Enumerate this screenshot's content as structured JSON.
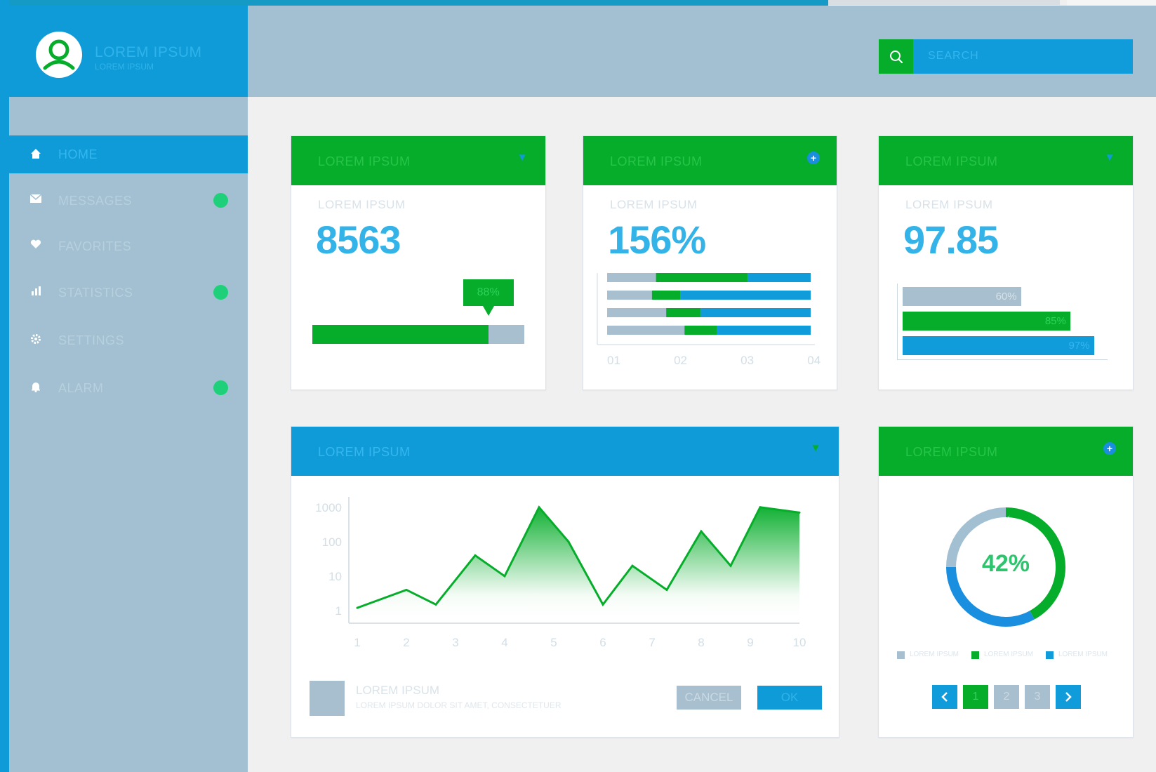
{
  "brand": {
    "title": "LOREM IPSUM",
    "subtitle": "LOREM IPSUM"
  },
  "search": {
    "placeholder": "SEARCH"
  },
  "nav": [
    {
      "label": "HOME",
      "icon": "home-icon",
      "glyph": "⌂",
      "active": true,
      "badge": false
    },
    {
      "label": "MESSAGES",
      "icon": "mail-icon",
      "glyph": "✉",
      "active": false,
      "badge": true
    },
    {
      "label": "FAVORITES",
      "icon": "heart-icon",
      "glyph": "♥",
      "active": false,
      "badge": false
    },
    {
      "label": "STATISTICS",
      "icon": "bar-chart-icon",
      "glyph": "▮",
      "active": false,
      "badge": true
    },
    {
      "label": "SETTINGS",
      "icon": "gear-icon",
      "glyph": "⚙",
      "active": false,
      "badge": false
    },
    {
      "label": "ALARM",
      "icon": "bell-icon",
      "glyph": "🔔",
      "active": false,
      "badge": true
    }
  ],
  "cards": {
    "kpi1": {
      "title": "LOREM IPSUM",
      "label": "LOREM IPSUM",
      "value": "8563",
      "progress_label": "88%",
      "progress": 0.83
    },
    "kpi2": {
      "title": "LOREM IPSUM",
      "label": "LOREM IPSUM",
      "value": "156%",
      "axis": [
        "01",
        "02",
        "03",
        "04"
      ]
    },
    "kpi3": {
      "title": "LOREM IPSUM",
      "label": "LOREM IPSUM",
      "value": "97.85",
      "bars": [
        {
          "label": "60%",
          "value": 0.6
        },
        {
          "label": "85%",
          "value": 0.85
        },
        {
          "label": "97%",
          "value": 0.97
        }
      ]
    },
    "line": {
      "title": "LOREM IPSUM",
      "footer_title": "LOREM IPSUM",
      "footer_sub": "LOREM IPSUM DOLOR SIT AMET, CONSECTETUER",
      "cancel": "CANCEL",
      "ok": "OK"
    },
    "donut": {
      "title": "LOREM IPSUM",
      "value": "42%",
      "legend": [
        "LOREM IPSUM",
        "LOREM IPSUM",
        "LOREM IPSUM"
      ],
      "pages": [
        "1",
        "2",
        "3"
      ],
      "prev": "‹",
      "next": "›"
    }
  },
  "colors": {
    "blue": "#0f9bd8",
    "green": "#06ad2a",
    "grey": "#a2c0d1",
    "accent": "#33b3e8",
    "badge": "#1fd07a"
  },
  "chart_data": [
    {
      "type": "line",
      "x": [
        1,
        2,
        3,
        4,
        5,
        6,
        7,
        8,
        9,
        10
      ],
      "y_ticks": [
        "1000",
        "100",
        "10",
        "1"
      ],
      "yscale": "log",
      "ylim": [
        1,
        2000
      ],
      "series": [
        {
          "values": [
            1.2,
            4,
            1.5,
            40,
            10,
            1000,
            100,
            1.5,
            20,
            4,
            200,
            20,
            1000,
            700
          ]
        }
      ],
      "x_points": [
        1,
        2,
        2.6,
        3.4,
        4,
        4.7,
        5.3,
        6,
        6.6,
        7.3,
        8,
        8.6,
        9.2,
        10
      ],
      "grid": false
    },
    {
      "type": "bar",
      "orientation": "horizontal-stacked",
      "categories": [
        "01",
        "02",
        "03",
        "04"
      ],
      "series": [
        {
          "values": [
            0.24,
            0.22,
            0.29,
            0.38
          ]
        },
        {
          "values": [
            0.45,
            0.14,
            0.17,
            0.16
          ]
        },
        {
          "values": [
            0.31,
            0.64,
            0.54,
            0.46
          ]
        }
      ]
    },
    {
      "type": "pie",
      "subtype": "donut",
      "value_label": "42%",
      "slices": [
        {
          "value": 42,
          "color": "#06ad2a"
        },
        {
          "value": 33,
          "color": "#1a8fe0"
        },
        {
          "value": 25,
          "color": "#a2c0d1"
        }
      ]
    }
  ]
}
